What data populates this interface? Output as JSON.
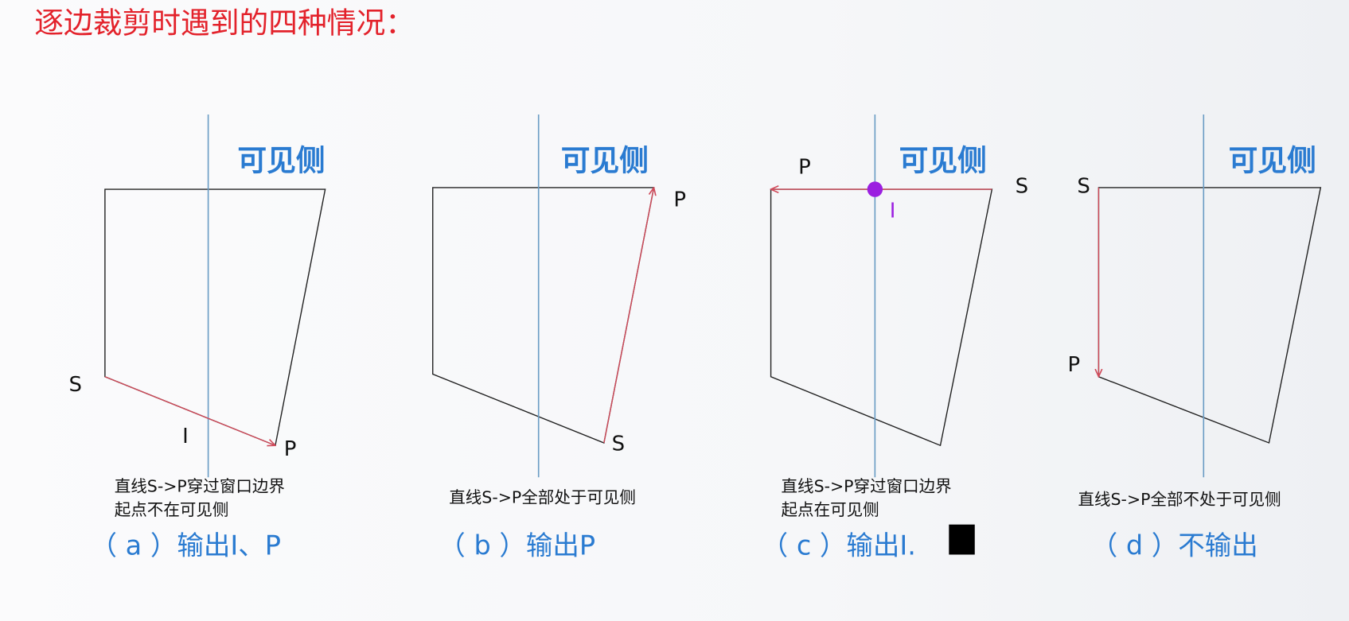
{
  "title": "逐边裁剪时遇到的四种情况：",
  "colors": {
    "title": "#e3222b",
    "label": "#2a7bd1",
    "edge": "#d04a5a",
    "intersection": "#9b1fe0",
    "window": "#6a9cc4"
  },
  "panels": [
    {
      "visible_label": "可见侧",
      "s": "S",
      "p": "P",
      "i": "I",
      "caption1": "直线S->P穿过窗口边界",
      "caption2": "起点不在可见侧",
      "result": "（ a ）输出I、P"
    },
    {
      "visible_label": "可见侧",
      "s": "S",
      "p": "P",
      "caption1": "直线S->P全部处于可见侧",
      "result": "（ b ）输出P"
    },
    {
      "visible_label": "可见侧",
      "s": "S",
      "p": "P",
      "i": "I",
      "caption1": "直线S->P穿过窗口边界",
      "caption2": "起点在可见侧",
      "result": "（ c ）输出I."
    },
    {
      "visible_label": "可见侧",
      "s": "S",
      "p": "P",
      "caption1": "直线S->P全部不处于可见侧",
      "result": "（ d ）不输出"
    }
  ]
}
